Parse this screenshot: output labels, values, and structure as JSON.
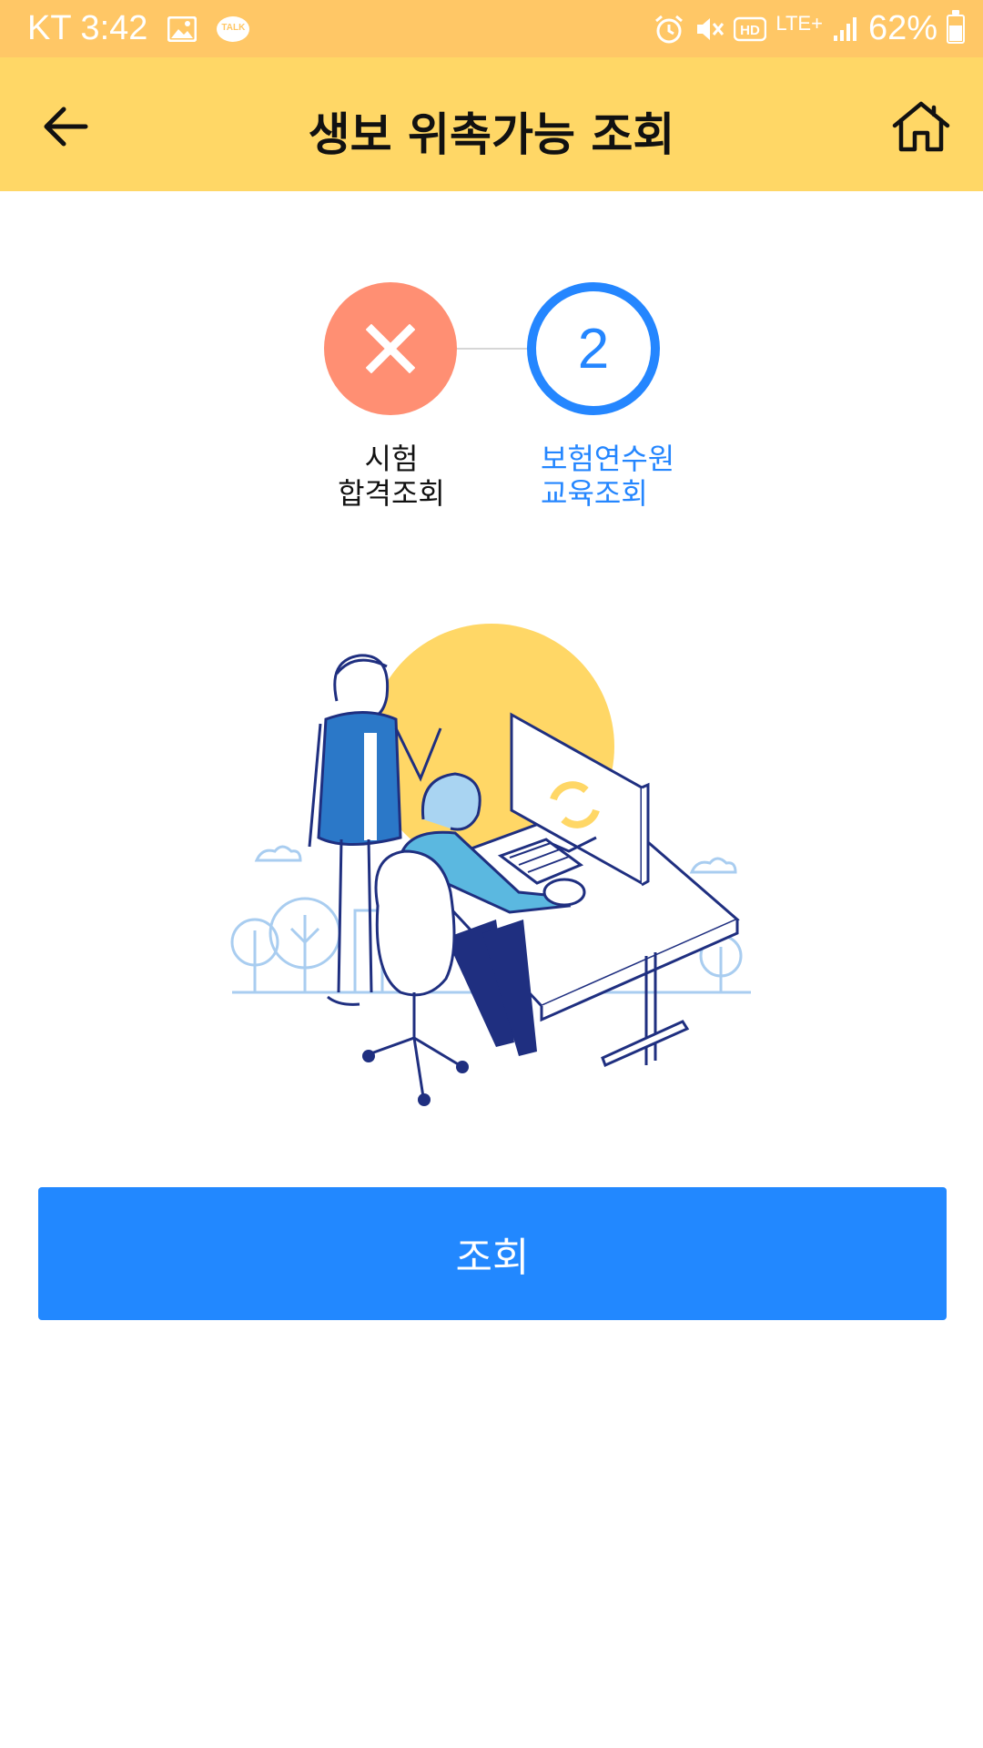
{
  "status_bar": {
    "carrier_time": "KT 3:42",
    "talk_badge": "TALK",
    "network": "LTE+",
    "battery": "62%",
    "icons": [
      "gallery-icon",
      "kakaotalk-icon",
      "alarm-icon",
      "mute-icon",
      "hd-icon",
      "lte-icon",
      "signal-icon",
      "battery-icon"
    ]
  },
  "app_bar": {
    "title": "생보 위촉가능 조회",
    "back_icon": "back-arrow-icon",
    "home_icon": "home-icon"
  },
  "steps": [
    {
      "status": "failed",
      "icon": "x-icon",
      "label_line1": "시험",
      "label_line2": "합격조회"
    },
    {
      "status": "current",
      "number": "2",
      "label_line1": "보험연수원",
      "label_line2": "교육조회"
    }
  ],
  "illustration": {
    "name": "office-illustration"
  },
  "button": {
    "label": "조회"
  },
  "colors": {
    "status_bar": "#ffc766",
    "app_bar": "#ffd766",
    "step_failed": "#ff8f73",
    "accent_blue": "#2486ff",
    "button": "#2288ff"
  }
}
